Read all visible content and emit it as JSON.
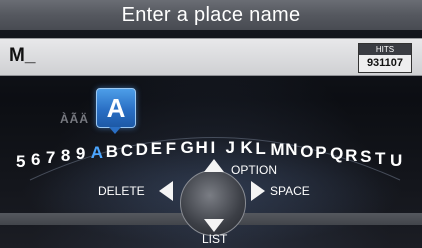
{
  "title": "Enter a place name",
  "input": {
    "value": "M_"
  },
  "hits": {
    "label": "HITS",
    "count": "931107"
  },
  "keyboard": {
    "accented_chars": "ÀÃÄ",
    "selected_char": "A",
    "chars": [
      "5",
      "6",
      "7",
      "8",
      "9",
      "A",
      "B",
      "C",
      "D",
      "E",
      "F",
      "G",
      "H",
      "I",
      "J",
      "K",
      "L",
      "M",
      "N",
      "O",
      "P",
      "Q",
      "R",
      "S",
      "T",
      "U"
    ],
    "selected_index": 5
  },
  "controls": {
    "up_label": "OPTION",
    "left_label": "DELETE",
    "right_label": "SPACE",
    "down_label": "LIST"
  },
  "colors": {
    "selected": "#4ca6ff",
    "badge": "#2a6fc4"
  }
}
